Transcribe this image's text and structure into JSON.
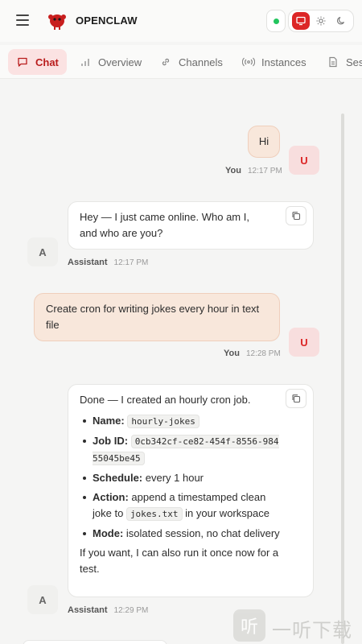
{
  "app": {
    "brand": "OPENCLAW"
  },
  "theme": {
    "accent": "#dc2626",
    "status_color": "#22c55e"
  },
  "tabs": [
    {
      "label": "Chat",
      "icon": "chat-icon",
      "active": true
    },
    {
      "label": "Overview",
      "icon": "bar-chart-icon"
    },
    {
      "label": "Channels",
      "icon": "link-icon"
    },
    {
      "label": "Instances",
      "icon": "broadcast-icon"
    },
    {
      "label": "Ses",
      "icon": "document-icon"
    }
  ],
  "messages": [
    {
      "role": "user",
      "text": "Hi",
      "author": "You",
      "time": "12:17 PM",
      "avatar": "U"
    },
    {
      "role": "assistant",
      "text": "Hey — I just came online. Who am I, and who are you?",
      "author": "Assistant",
      "time": "12:17 PM",
      "avatar": "A"
    },
    {
      "role": "user",
      "text": "Create cron for writing jokes every hour in text file",
      "author": "You",
      "time": "12:28 PM",
      "avatar": "U"
    },
    {
      "role": "assistant",
      "intro": "Done — I created an hourly cron job.",
      "items": [
        {
          "label": "Name:",
          "code": "hourly-jokes"
        },
        {
          "label": "Job ID:",
          "code": "0cb342cf-ce82-454f-8556-98455045be45"
        },
        {
          "label": "Schedule:",
          "text": "every 1 hour"
        },
        {
          "label": "Action:",
          "text_before": "append a timestamped clean joke to",
          "code": "jokes.txt",
          "text_after": "in your workspace"
        },
        {
          "label": "Mode:",
          "text": "isolated session, no chat delivery"
        }
      ],
      "outro": "If you want, I can also run it once now for a test.",
      "author": "Assistant",
      "time": "12:29 PM",
      "avatar": "A"
    }
  ],
  "watermark": {
    "text": "一听下载",
    "glyph": "听"
  }
}
